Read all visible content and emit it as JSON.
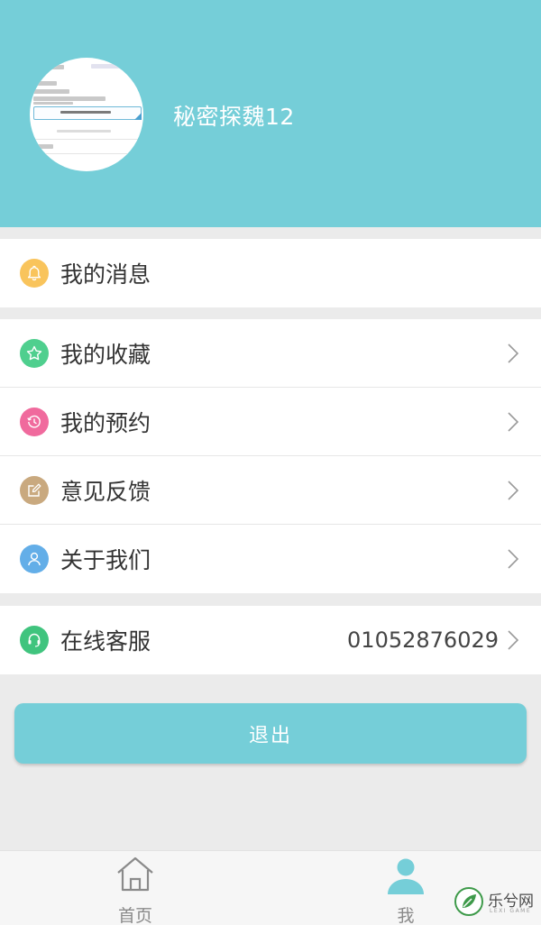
{
  "profile": {
    "username": "秘密探魏12"
  },
  "menu": {
    "messages": {
      "label": "我的消息",
      "icon": "bell-icon",
      "color": "#f9c45c"
    },
    "favorites": {
      "label": "我的收藏",
      "icon": "star-icon",
      "color": "#4fcf8e"
    },
    "appointments": {
      "label": "我的预约",
      "icon": "history-clock-icon",
      "color": "#f06a9d"
    },
    "feedback": {
      "label": "意见反馈",
      "icon": "edit-icon",
      "color": "#c9a97f"
    },
    "about": {
      "label": "关于我们",
      "icon": "person-icon",
      "color": "#63aee8"
    },
    "service": {
      "label": "在线客服",
      "icon": "headset-icon",
      "color": "#40c47e",
      "phone": "01052876029"
    }
  },
  "logout": {
    "label": "退出"
  },
  "tabbar": {
    "home": {
      "label": "首页",
      "icon": "home-icon"
    },
    "me": {
      "label": "我",
      "icon": "user-icon",
      "active_color": "#75ced8"
    }
  },
  "watermark": {
    "text": "乐兮网",
    "sub": "LEXI GAME"
  },
  "colors": {
    "accent": "#75ced8",
    "background": "#ebebeb"
  }
}
